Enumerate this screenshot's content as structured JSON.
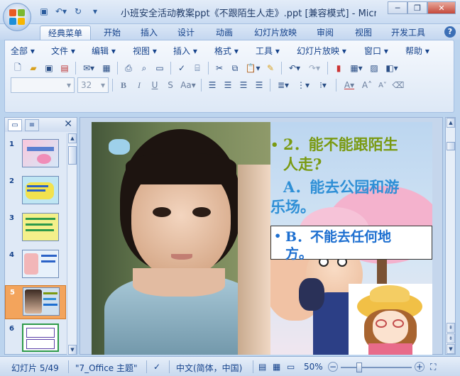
{
  "window": {
    "title": "小班安全活动教案ppt《不跟陌生人走》.ppt [兼容模式] - Micr...",
    "minimize": "─",
    "maximize": "❐",
    "close": "✕"
  },
  "ribbon_tabs": [
    "经典菜单",
    "开始",
    "插入",
    "设计",
    "动画",
    "幻灯片放映",
    "审阅",
    "视图",
    "开发工具"
  ],
  "help": "?",
  "menus": [
    "全部 ▾",
    "文件 ▾",
    "编辑 ▾",
    "视图 ▾",
    "插入 ▾",
    "格式 ▾",
    "工具 ▾",
    "幻灯片放映 ▾",
    "窗口 ▾",
    "帮助 ▾"
  ],
  "font": {
    "name": "",
    "size": "32"
  },
  "slides_panel": {
    "tab_slides": "▭",
    "tab_outline": "≡",
    "close": "✕",
    "numbers": [
      "1",
      "2",
      "3",
      "4",
      "5",
      "6"
    ],
    "selected": "5"
  },
  "slide": {
    "q_bullet": "•",
    "q_line1": "2．能不能跟陌生",
    "q_line2": "人走?",
    "a_line1": "A．能去公园和游",
    "a_line2": "乐场。",
    "b_bullet": "•",
    "b_line1": "B．不能去任何地",
    "b_line2": "方。",
    "colors": {
      "question": "#7a9a12",
      "answer_a": "#2e8fd6",
      "answer_b": "#1d6fd0"
    }
  },
  "status": {
    "slide_info": "幻灯片 5/49",
    "theme": "\"7_Office 主题\"",
    "language": "中文(简体，中国)",
    "zoom": "50%",
    "zoom_minus": "−",
    "zoom_plus": "+"
  }
}
